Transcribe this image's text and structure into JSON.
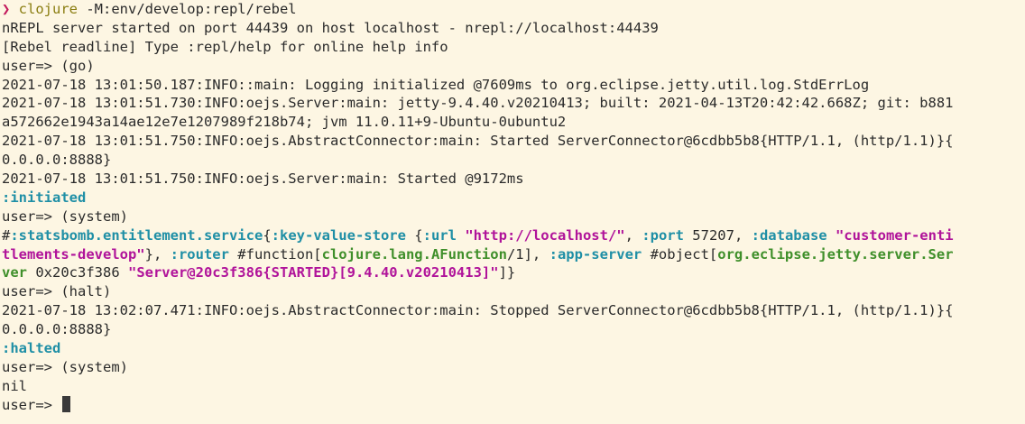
{
  "theme": {
    "background": "#fdf6e3",
    "text": "#2b2b2b",
    "keyword": "#1f8fa6",
    "string": "#b0139a",
    "class": "#3f8f2a",
    "prompt_arrow": "#c2185b",
    "command": "#8a7d10"
  },
  "terminal": {
    "lines": [
      [
        {
          "t": "❯ ",
          "c": "prompt-arrow"
        },
        {
          "t": "clojure ",
          "c": "cmd"
        },
        {
          "t": "-M:env/develop:repl/rebel"
        }
      ],
      [
        {
          "t": "nREPL server started on port 44439 on host localhost - nrepl://localhost:44439"
        }
      ],
      [
        {
          "t": "[Rebel readline] Type :repl/help for online help info"
        }
      ],
      [
        {
          "t": "user=> (go)"
        }
      ],
      [
        {
          "t": "2021-07-18 13:01:50.187:INFO::main: Logging initialized @7609ms to org.eclipse.jetty.util.log.StdErrLog"
        }
      ],
      [
        {
          "t": "2021-07-18 13:01:51.730:INFO:oejs.Server:main: jetty-9.4.40.v20210413; built: 2021-04-13T20:42:42.668Z; git: b881"
        }
      ],
      [
        {
          "t": "a572662e1943a14ae12e7e1207989f218b74; jvm 11.0.11+9-Ubuntu-0ubuntu2"
        }
      ],
      [
        {
          "t": "2021-07-18 13:01:51.750:INFO:oejs.AbstractConnector:main: Started ServerConnector@6cdbb5b8{HTTP/1.1, (http/1.1)}{"
        }
      ],
      [
        {
          "t": "0.0.0.0:8888}"
        }
      ],
      [
        {
          "t": "2021-07-18 13:01:51.750:INFO:oejs.Server:main: Started @9172ms"
        }
      ],
      [
        {
          "t": ":initiated",
          "c": "kw"
        }
      ],
      [
        {
          "t": "user=> (system)"
        }
      ],
      [
        {
          "t": "#"
        },
        {
          "t": ":statsbomb.entitlement.service",
          "c": "kw"
        },
        {
          "t": "{"
        },
        {
          "t": ":key-value-store",
          "c": "kw"
        },
        {
          "t": " {"
        },
        {
          "t": ":url",
          "c": "kw"
        },
        {
          "t": " "
        },
        {
          "t": "\"http://localhost/\"",
          "c": "str"
        },
        {
          "t": ", "
        },
        {
          "t": ":port",
          "c": "kw"
        },
        {
          "t": " 57207, "
        },
        {
          "t": ":database",
          "c": "kw"
        },
        {
          "t": " "
        },
        {
          "t": "\"customer-enti",
          "c": "str"
        }
      ],
      [
        {
          "t": "tlements-develop\"",
          "c": "str"
        },
        {
          "t": "}, "
        },
        {
          "t": ":router",
          "c": "kw"
        },
        {
          "t": " #function["
        },
        {
          "t": "clojure.lang.AFunction",
          "c": "cls"
        },
        {
          "t": "/1], "
        },
        {
          "t": ":app-server",
          "c": "kw"
        },
        {
          "t": " #object["
        },
        {
          "t": "org.eclipse.jetty.server.Ser",
          "c": "cls"
        }
      ],
      [
        {
          "t": "ver",
          "c": "cls"
        },
        {
          "t": " 0x20c3f386 "
        },
        {
          "t": "\"Server@20c3f386{STARTED}[9.4.40.v20210413]\"",
          "c": "str"
        },
        {
          "t": "]}"
        }
      ],
      [
        {
          "t": "user=> (halt)"
        }
      ],
      [
        {
          "t": "2021-07-18 13:02:07.471:INFO:oejs.AbstractConnector:main: Stopped ServerConnector@6cdbb5b8{HTTP/1.1, (http/1.1)}{"
        }
      ],
      [
        {
          "t": "0.0.0.0:8888}"
        }
      ],
      [
        {
          "t": ":halted",
          "c": "kw"
        }
      ],
      [
        {
          "t": "user=> (system)"
        }
      ],
      [
        {
          "t": "nil"
        }
      ],
      [
        {
          "t": "user=> "
        }
      ]
    ]
  }
}
